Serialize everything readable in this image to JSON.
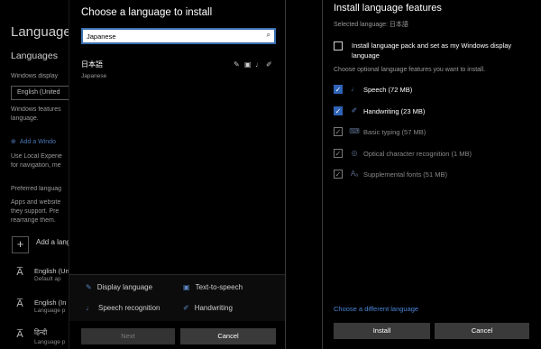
{
  "background": {
    "title": "Language",
    "subtitle": "Languages",
    "display_label": "Windows display",
    "display_value": "English (United",
    "features_text_1": "Windows features",
    "features_text_2": "language.",
    "add_windows_label": "Add a Windo",
    "local_text_1": "Use Local Experie",
    "local_text_2": "for navigation, me",
    "preferred_label": "Preferred languag",
    "apps_text_1": "Apps and website",
    "apps_text_2": "they support. Pre",
    "apps_text_3": "rearrange them.",
    "add_lang_label": "Add a lang",
    "lang_items": [
      {
        "name": "English (Un",
        "sub": "Default ap"
      },
      {
        "name": "English (In",
        "sub": "Language p"
      },
      {
        "name": "हिन्दी",
        "sub": "Language p"
      }
    ]
  },
  "choose_dialog": {
    "title": "Choose a language to install",
    "search_value": "Japanese",
    "result": {
      "native": "日本語",
      "english": "Japanese"
    },
    "legend": {
      "display_language": "Display language",
      "text_to_speech": "Text-to-speech",
      "speech_recognition": "Speech recognition",
      "handwriting": "Handwriting"
    },
    "next_label": "Next",
    "cancel_label": "Cancel"
  },
  "install_dialog": {
    "title": "Install language features",
    "selected_language": "Selected language: 日本語",
    "pack_label": "Install language pack and set as my Windows display language",
    "choose_features": "Choose optional language features you want to install.",
    "features": [
      {
        "label": "Speech (72 MB)",
        "checked": true,
        "disabled": false,
        "icon": "microphone-icon"
      },
      {
        "label": "Handwriting (23 MB)",
        "checked": true,
        "disabled": false,
        "icon": "pen-icon"
      },
      {
        "label": "Basic typing (57 MB)",
        "checked": true,
        "disabled": true,
        "icon": "keyboard-icon"
      },
      {
        "label": "Optical character recognition (1 MB)",
        "checked": true,
        "disabled": true,
        "icon": "ocr-icon"
      },
      {
        "label": "Supplemental fonts (51 MB)",
        "checked": true,
        "disabled": true,
        "icon": "font-icon"
      }
    ],
    "choose_different": "Choose a different language",
    "install_label": "Install",
    "cancel_label": "Cancel"
  },
  "colors": {
    "accent": "#2f63b8",
    "link": "#4a85d8",
    "background": "#000000"
  }
}
